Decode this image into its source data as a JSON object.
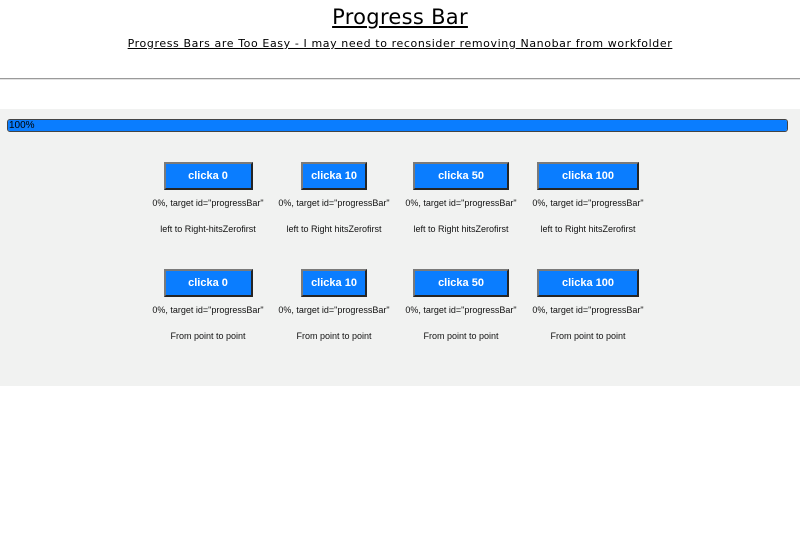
{
  "header": {
    "title": "Progress Bar",
    "subtitle": "Progress Bars are Too Easy - I may need to reconsider removing Nanobar from workfolder"
  },
  "progress": {
    "label": "100%",
    "value_percent": 100,
    "color": "#0a7dff"
  },
  "rows": [
    {
      "buttons": [
        {
          "label": "clicka 0",
          "info": "0%, target id=\"progressBar\"",
          "mode": "left to Right-hitsZerofirst"
        },
        {
          "label": "clicka 10",
          "info": "0%, target id=\"progressBar\"",
          "mode": "left to Right hitsZerofirst"
        },
        {
          "label": "clicka 50",
          "info": "0%, target id=\"progressBar\"",
          "mode": "left to Right hitsZerofirst"
        },
        {
          "label": "clicka 100",
          "info": "0%, target id=\"progressBar\"",
          "mode": "left to Right hitsZerofirst"
        }
      ]
    },
    {
      "buttons": [
        {
          "label": "clicka 0",
          "info": "0%, target id=\"progressBar\"",
          "mode": "From point to point"
        },
        {
          "label": "clicka 10",
          "info": "0%, target id=\"progressBar\"",
          "mode": "From point to point"
        },
        {
          "label": "clicka 50",
          "info": "0%, target id=\"progressBar\"",
          "mode": "From point to point"
        },
        {
          "label": "clicka 100",
          "info": "0%, target id=\"progressBar\"",
          "mode": "From point to point"
        }
      ]
    }
  ]
}
